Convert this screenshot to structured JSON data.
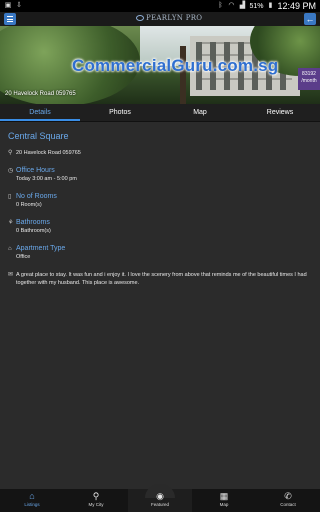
{
  "status_bar": {
    "battery": "51%",
    "time": "12:49 PM"
  },
  "app_bar": {
    "logo_text": "PEARLYN PRO"
  },
  "hero": {
    "watermark": "CommercialGuru.com.sg",
    "address_overlay": "20 Havelock Road 059765",
    "price_line1": "83192",
    "price_line2": "/month"
  },
  "tabs": [
    {
      "label": "Details",
      "active": true
    },
    {
      "label": "Photos",
      "active": false
    },
    {
      "label": "Map",
      "active": false
    },
    {
      "label": "Reviews",
      "active": false
    }
  ],
  "details": {
    "title": "Central Square",
    "address": "20 Havelock Road 059765",
    "office_hours_label": "Office Hours",
    "office_hours_value": "Today 3:00 am - 5:00 pm",
    "rooms_label": "No of Rooms",
    "rooms_value": "0 Room(s)",
    "bathrooms_label": "Bathrooms",
    "bathrooms_value": "0 Bathroom(s)",
    "apartment_type_label": "Apartment Type",
    "apartment_type_value": "Office",
    "description": "A great place to stay. It was fun and i enjoy it. I love the scenery from above that reminds me of the beautiful times I had together with my husband. This place is awesome."
  },
  "bottom_nav": [
    {
      "label": "Listings",
      "icon": "home-icon",
      "active": true
    },
    {
      "label": "My City",
      "icon": "location-pin-icon",
      "active": false
    },
    {
      "label": "Featured",
      "icon": "eye-icon",
      "active": false
    },
    {
      "label": "Map",
      "icon": "map-icon",
      "active": false
    },
    {
      "label": "Contact",
      "icon": "phone-icon",
      "active": false
    }
  ],
  "colors": {
    "accent": "#6aa8ea",
    "background": "#2b2b2b",
    "badge": "#5b3d8a"
  }
}
